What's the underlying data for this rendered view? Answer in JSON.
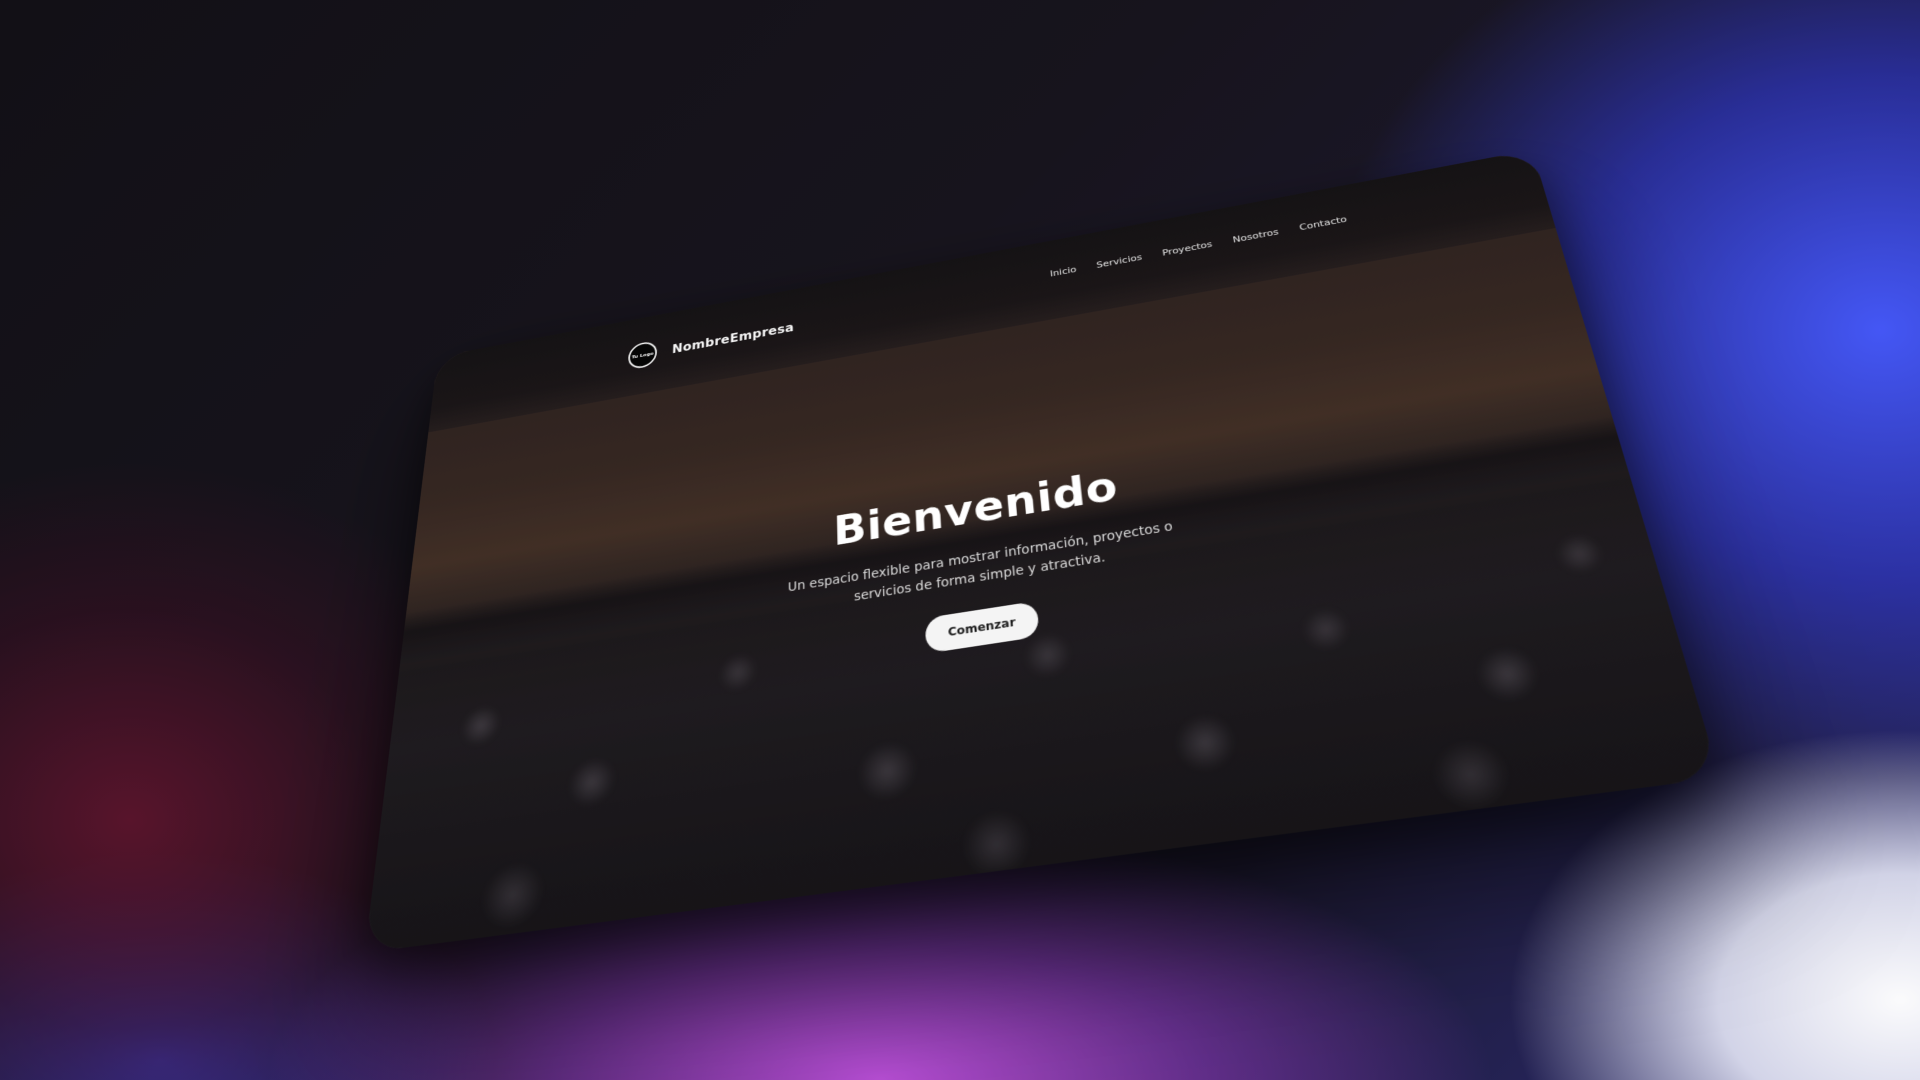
{
  "brand": {
    "logo_text": "Tu Logo",
    "name": "NombreEmpresa"
  },
  "nav": {
    "links": [
      "Inicio",
      "Servicios",
      "Proyectos",
      "Nosotros",
      "Contacto"
    ]
  },
  "hero": {
    "title": "Bienvenido",
    "subtitle": "Un espacio flexible para mostrar información, proyectos o servicios de forma simple y atractiva.",
    "button_label": "Comenzar"
  },
  "colors": {
    "navbar_bg": "#151215",
    "button_bg": "#f4f4f4",
    "button_text": "#1b1b1b",
    "text_primary": "#ffffff"
  },
  "icons": {
    "logo": "circle-logo-icon"
  }
}
